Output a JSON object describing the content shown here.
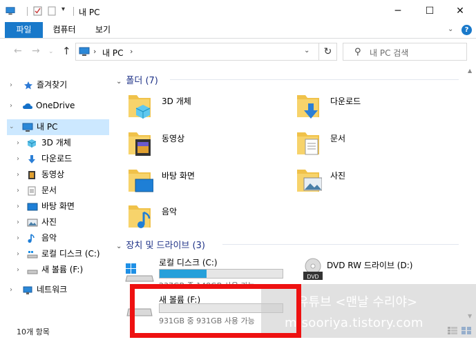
{
  "window": {
    "title": "내 PC",
    "controls": {
      "minimize": "─",
      "maximize": "☐",
      "close": "✕"
    }
  },
  "ribbon": {
    "tabs": [
      {
        "label": "파일"
      },
      {
        "label": "컴퓨터"
      },
      {
        "label": "보기"
      }
    ],
    "help": "?",
    "expand": "⌄"
  },
  "address": {
    "path_root": "내 PC",
    "separator": "›",
    "dropdown": "⌄",
    "refresh": "↻"
  },
  "search": {
    "placeholder": "내 PC 검색",
    "icon": "search-icon"
  },
  "nav": {
    "quick_access": "즐겨찾기",
    "onedrive": "OneDrive",
    "this_pc": "내 PC",
    "pc_items": [
      {
        "label": "3D 개체"
      },
      {
        "label": "다운로드"
      },
      {
        "label": "동영상"
      },
      {
        "label": "문서"
      },
      {
        "label": "바탕 화면"
      },
      {
        "label": "사진"
      },
      {
        "label": "음악"
      },
      {
        "label": "로컬 디스크 (C:)"
      },
      {
        "label": "새 볼륨 (F:)"
      }
    ],
    "network": "네트워크"
  },
  "content": {
    "folders_header": "폴더 (7)",
    "folders": [
      {
        "label": "3D 개체",
        "icon": "3d-objects-folder-icon"
      },
      {
        "label": "다운로드",
        "icon": "downloads-folder-icon"
      },
      {
        "label": "동영상",
        "icon": "videos-folder-icon"
      },
      {
        "label": "문서",
        "icon": "documents-folder-icon"
      },
      {
        "label": "바탕 화면",
        "icon": "desktop-folder-icon"
      },
      {
        "label": "사진",
        "icon": "pictures-folder-icon"
      },
      {
        "label": "음악",
        "icon": "music-folder-icon"
      }
    ],
    "devices_header": "장치 및 드라이브 (3)",
    "drives": [
      {
        "label": "로컬 디스크 (C:)",
        "info": "237GB 중 148GB 사용 가능",
        "used_fraction": 0.38
      },
      {
        "label": "새 볼륨 (F:)",
        "info": "931GB 중 931GB 사용 가능",
        "used_fraction": 0.0
      },
      {
        "label": "DVD RW 드라이브 (D:)",
        "icon_text": "DVD"
      }
    ]
  },
  "status": {
    "item_count": "10개 항목"
  },
  "watermark": {
    "line1": "유튜브 <맨날 수리야>",
    "line2": "m-sooriya.tistory.com"
  },
  "colors": {
    "accent": "#1979ca",
    "selection": "#cce8ff",
    "drive_bar": "#26a0da",
    "highlight_box": "#ee1111"
  }
}
